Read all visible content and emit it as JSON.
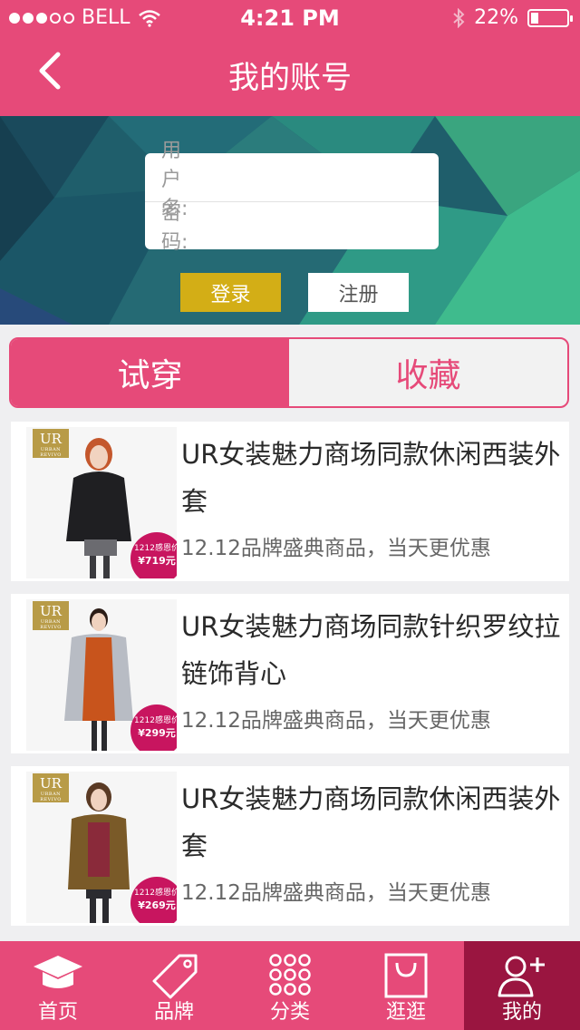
{
  "status_bar": {
    "carrier": "BELL",
    "time": "4:21 PM",
    "battery": "22%",
    "battery_level": 0.22
  },
  "nav": {
    "title": "我的账号"
  },
  "login": {
    "username_label": "用户名:",
    "password_label": "密　码:",
    "login_button": "登录",
    "register_button": "注册"
  },
  "tabs": [
    {
      "label": "试穿",
      "active": true
    },
    {
      "label": "收藏",
      "active": false
    }
  ],
  "products": [
    {
      "name": "UR女装魅力商场同款休闲西装外套",
      "desc": "12.12品牌盛典商品，当天更优惠",
      "badge_label": "1212感恩价",
      "price": "¥719元",
      "logo": "UR",
      "logo_sub": "URBAN REVIVO"
    },
    {
      "name": "UR女装魅力商场同款针织罗纹拉链饰背心",
      "desc": "12.12品牌盛典商品，当天更优惠",
      "badge_label": "1212感恩价",
      "price": "¥299元",
      "logo": "UR",
      "logo_sub": "URBAN REVIVO"
    },
    {
      "name": "UR女装魅力商场同款休闲西装外套",
      "desc": "12.12品牌盛典商品，当天更优惠",
      "badge_label": "1212感恩价",
      "price": "¥269元",
      "logo": "UR",
      "logo_sub": "URBAN REVIVO"
    }
  ],
  "tabbar": [
    {
      "label": "首页",
      "icon": "graduation-cap-icon",
      "active": false
    },
    {
      "label": "品牌",
      "icon": "tag-icon",
      "active": false
    },
    {
      "label": "分类",
      "icon": "grid-dots-icon",
      "active": false
    },
    {
      "label": "逛逛",
      "icon": "shopping-bag-icon",
      "active": false
    },
    {
      "label": "我的",
      "icon": "add-user-icon",
      "active": true
    }
  ],
  "colors": {
    "brand": "#e64a79",
    "tab_active_bg": "#9a1540",
    "login_button": "#d3ae16",
    "price_badge": "#c8155f"
  }
}
